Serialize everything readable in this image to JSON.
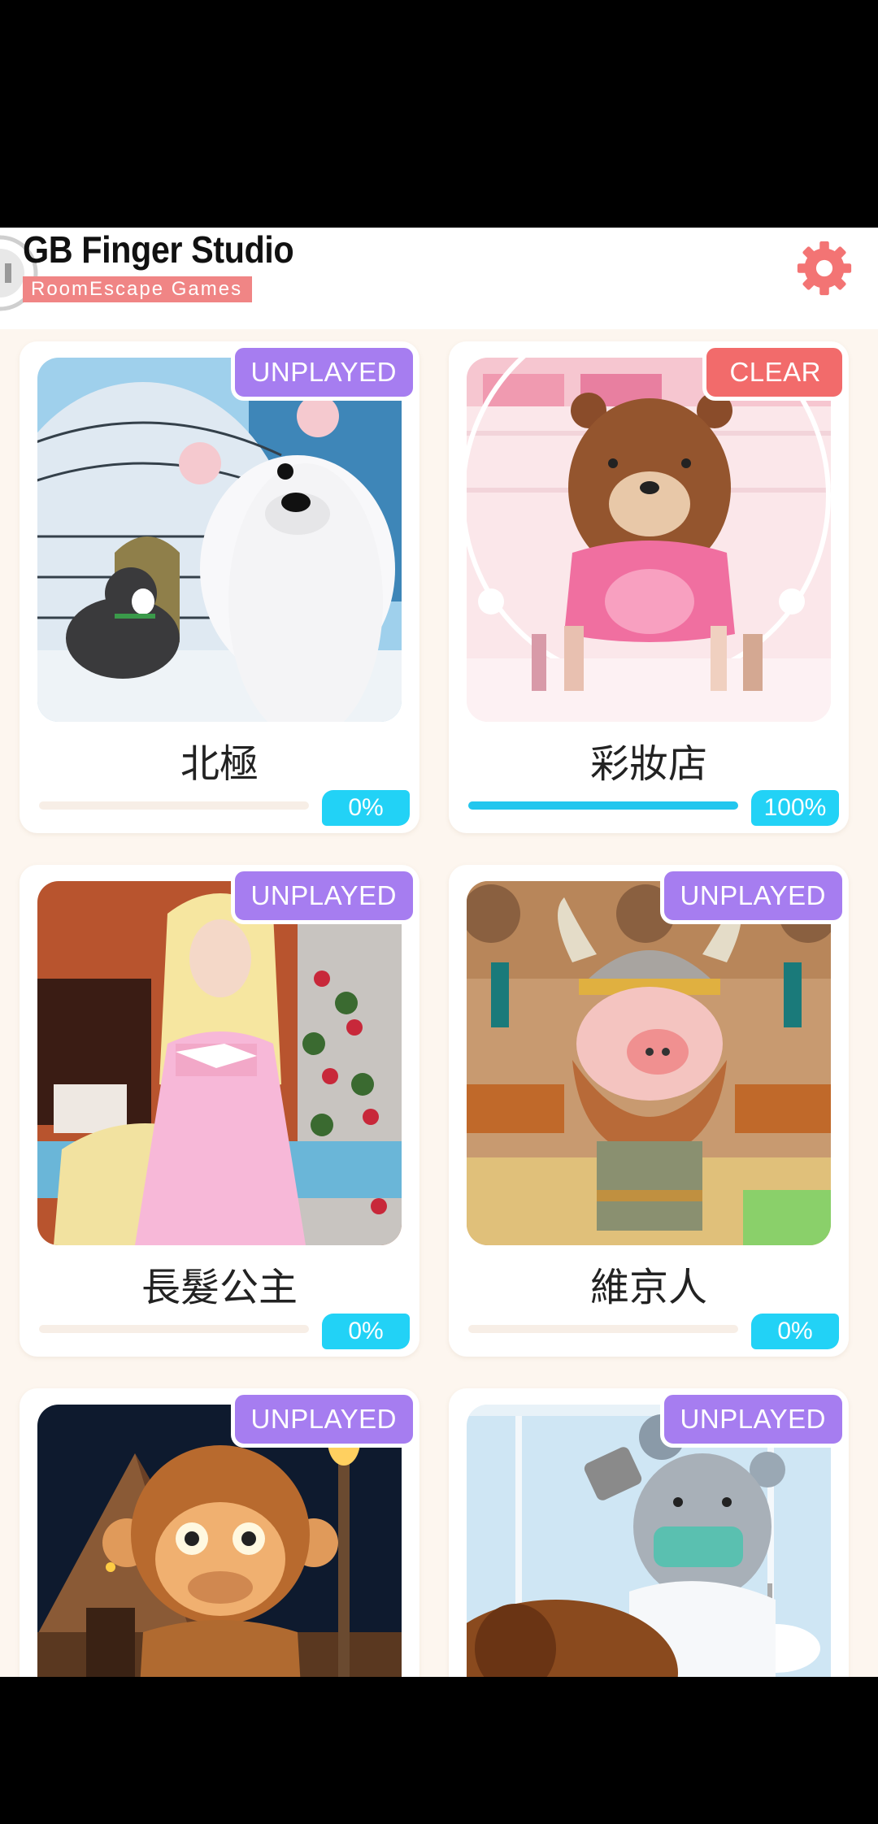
{
  "header": {
    "title": "GB Finger Studio",
    "subtitle": "RoomEscape  Games",
    "settings_icon": "gear-icon",
    "accent": "#f37474"
  },
  "levels": [
    {
      "title": "北極",
      "badge": "UNPLAYED",
      "progress": "0%",
      "progress_value": 0
    },
    {
      "title": "彩妝店",
      "badge": "CLEAR",
      "progress": "100%",
      "progress_value": 100
    },
    {
      "title": "長髮公主",
      "badge": "UNPLAYED",
      "progress": "0%",
      "progress_value": 0
    },
    {
      "title": "維京人",
      "badge": "UNPLAYED",
      "progress": "0%",
      "progress_value": 0
    },
    {
      "title": "",
      "badge": "UNPLAYED",
      "progress": "",
      "progress_value": 0
    },
    {
      "title": "",
      "badge": "UNPLAYED",
      "progress": "",
      "progress_value": 0
    }
  ],
  "colors": {
    "unplayed_badge": "#a67df0",
    "clear_badge": "#f26b6b",
    "progress": "#22d2f6",
    "background": "#fdf6ef"
  }
}
